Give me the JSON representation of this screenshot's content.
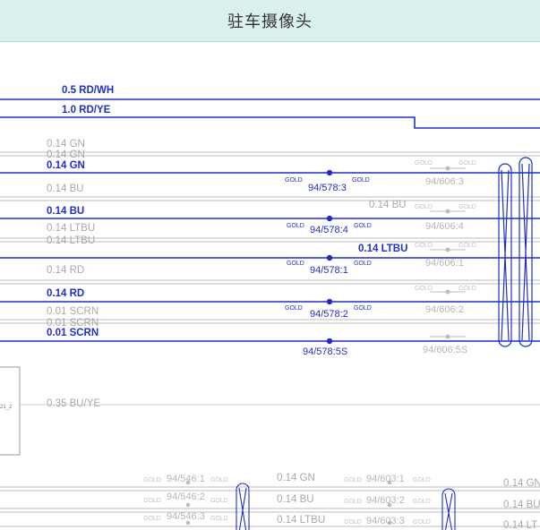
{
  "header": {
    "title": "驻车摄像头"
  },
  "wire_labels": {
    "rd_wh": "0.5 RD/WH",
    "rd_ye": "1.0 RD/YE",
    "gn_ghost1": "0.14 GN",
    "gn_ghost2": "0.14 GN",
    "gn": "0.14 GN",
    "bu_ghost": "0.14 BU",
    "bu": "0.14 BU",
    "ltbu_ghost1": "0.14 LTBU",
    "ltbu_ghost2": "0.14 LTBU",
    "rd_ghost": "0.14 RD",
    "rd": "0.14 RD",
    "scrn_ghost1": "0.01 SCRN",
    "scrn_ghost2": "0.01 SCRN",
    "scrn": "0.01 SCRN",
    "bu_mid": "0.14 BU",
    "ltbu_mid": "0.14 LTBU",
    "bu_ye": "0.35 BU/YE",
    "bot_gn": "0.14 GN",
    "bot_bu": "0.14 BU",
    "bot_ltbu": "0.14 LTBU",
    "right_gn": "0.14 GN",
    "right_bu": "0.14 BU",
    "right_ltbu": "0.14 LT"
  },
  "connectors": {
    "c3": "94/578:3",
    "c4": "94/578:4",
    "c1": "94/578:1",
    "c2": "94/578:2",
    "c5s": "94/578:5S",
    "g3": "94/606:3",
    "g4": "94/606:4",
    "g1": "94/606:1",
    "g2": "94/606:2",
    "g5s": "94/606:5S",
    "b546_1": "94/546:1",
    "b546_2": "94/546:2",
    "b546_3": "94/546:3",
    "b603_1": "94/603:1",
    "b603_2": "94/603:2",
    "b603_3": "94/603:3"
  },
  "gold": "GOLD",
  "side_box_label": "21_2",
  "colors": {
    "wire": "#1f2fc8",
    "ghost": "#b8b8b8",
    "header_bg": "#d9f0ee"
  }
}
